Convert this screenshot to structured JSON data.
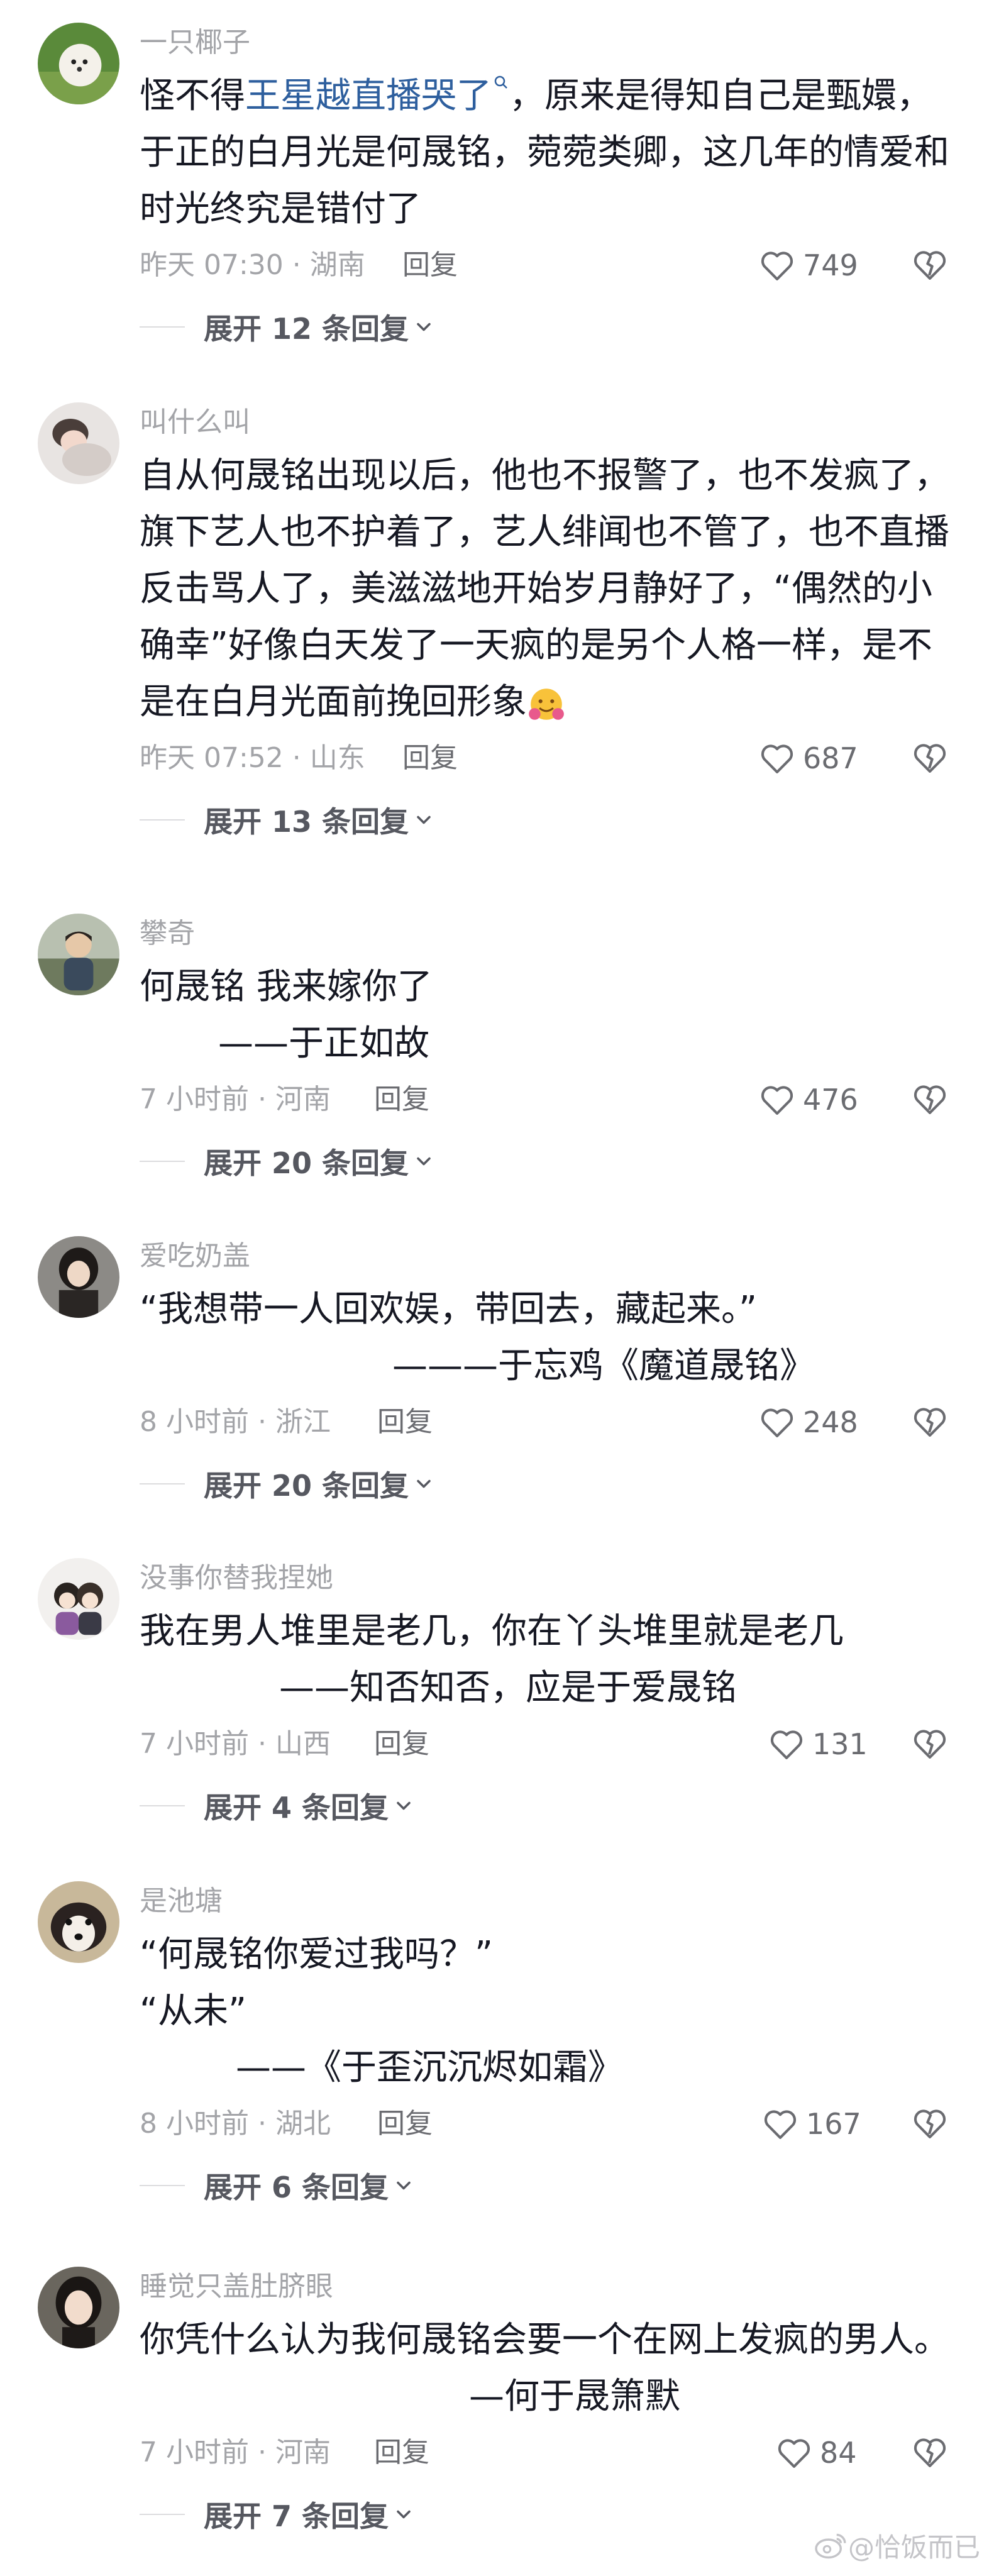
{
  "comments": [
    {
      "username": "一只椰子",
      "lines": [
        "王星越直播哭了",
        "，原来是得知自己是甄嬛，",
        "于正的白月光是何晟铭，菀菀类卿，这几年的情爱和",
        "时光终究是错付了"
      ],
      "line0_prefix": "怪不得",
      "meta": "昨天 07:30 · 湖南",
      "reply": "回复",
      "likes": "749",
      "expand": "展开 12 条回复"
    },
    {
      "username": "叫什么叫",
      "lines": [
        "自从何晟铭出现以后，他也不报警了，也不发疯了，",
        "旗下艺人也不护着了，艺人绯闻也不管了，也不直播",
        "反击骂人了，美滋滋地开始岁月静好了，“偶然的小",
        "确幸”好像白天发了一天疯的是另个人格一样，是不",
        "是在白月光面前挽回形象"
      ],
      "meta": "昨天 07:52 · 山东",
      "reply": "回复",
      "likes": "687",
      "expand": "展开 13 条回复"
    },
    {
      "username": "攀奇",
      "lines": [
        "何晟铭 我来嫁你了",
        "——于正如故"
      ],
      "meta": "7 小时前 · 河南",
      "reply": "回复",
      "likes": "476",
      "expand": "展开 20 条回复"
    },
    {
      "username": "爱吃奶盖",
      "lines": [
        "“我想带一人回欢娱，带回去，藏起来。”",
        "———于忘鸡《魔道晟铭》"
      ],
      "meta": "8 小时前 · 浙江",
      "reply": "回复",
      "likes": "248",
      "expand": "展开 20 条回复"
    },
    {
      "username": "没事你替我捏她",
      "lines": [
        "我在男人堆里是老几，你在丫头堆里就是老几",
        "——知否知否，应是于爱晟铭"
      ],
      "meta": "7 小时前 · 山西",
      "reply": "回复",
      "likes": "131",
      "expand": "展开 4 条回复"
    },
    {
      "username": "是池塘",
      "lines": [
        "“何晟铭你爱过我吗？”",
        "“从未”",
        "——《于歪沉沉烬如霜》"
      ],
      "meta": "8 小时前 · 湖北",
      "reply": "回复",
      "likes": "167",
      "expand": "展开 6 条回复"
    },
    {
      "username": "睡觉只盖肚脐眼",
      "lines": [
        "你凭什么认为我何晟铭会要一个在网上发疯的男人。",
        "—何于晟箫默"
      ],
      "meta": "7 小时前 · 河南",
      "reply": "回复",
      "likes": "84",
      "expand": "展开 7 条回复"
    }
  ],
  "watermark": "@恰饭而已",
  "colors": {
    "mention": "#2e5f9e",
    "meta": "#a3a4a8",
    "text": "#161823"
  }
}
